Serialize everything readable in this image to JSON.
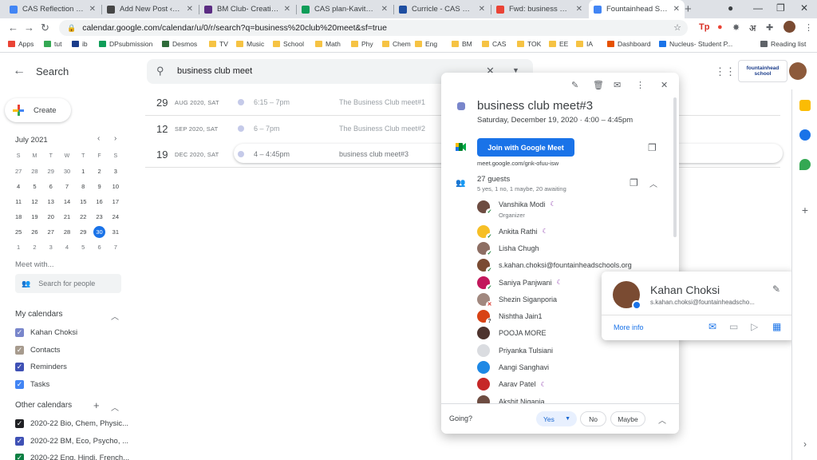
{
  "browser": {
    "tabs": [
      {
        "title": "CAS Reflection format",
        "color": "#4285f4"
      },
      {
        "title": "Add New Post ‹ — Wo",
        "color": "#464646"
      },
      {
        "title": "BM Club- Creativity",
        "color": "#5b2c83"
      },
      {
        "title": "CAS plan-Kavita Agar",
        "color": "#0f9d58"
      },
      {
        "title": "Curricle - CAS Class o",
        "color": "#1e4ea1"
      },
      {
        "title": "Fwd: business club ev",
        "color": "#ea4335"
      },
      {
        "title": "Fountainhead School",
        "color": "#4285f4"
      }
    ],
    "url": "calendar.google.com/calendar/u/0/r/search?q=business%20club%20meet&sf=true",
    "extensions": [
      "Tp",
      "अ"
    ],
    "bookmarks": [
      {
        "label": "Apps",
        "color": "#ea4335"
      },
      {
        "label": "tut",
        "color": "#34a853"
      },
      {
        "label": "ib",
        "color": "#1a3c8a"
      },
      {
        "label": "DPsubmission",
        "color": "#0f9d58"
      },
      {
        "label": "Desmos",
        "color": "#2f6b3a"
      },
      {
        "label": "TV",
        "color": "#f6c343"
      },
      {
        "label": "Music",
        "color": "#f6c343"
      },
      {
        "label": "School",
        "color": "#f6c343"
      },
      {
        "label": "Math",
        "color": "#f6c343"
      },
      {
        "label": "Phy",
        "color": "#f6c343"
      },
      {
        "label": "Chem",
        "color": "#f6c343"
      },
      {
        "label": "Eng",
        "color": "#f6c343"
      },
      {
        "label": "BM",
        "color": "#f6c343"
      },
      {
        "label": "CAS",
        "color": "#f6c343"
      },
      {
        "label": "TOK",
        "color": "#f6c343"
      },
      {
        "label": "EE",
        "color": "#f6c343"
      },
      {
        "label": "IA",
        "color": "#f6c343"
      },
      {
        "label": "Dashboard",
        "color": "#e65100"
      },
      {
        "label": "Nucleus- Student P...",
        "color": "#1a73e8"
      }
    ],
    "reading_list": "Reading list"
  },
  "header": {
    "page_title": "Search",
    "query": "business club meet",
    "org_logo": "fountainhead school"
  },
  "sidebar": {
    "create_label": "Create",
    "month_title": "July 2021",
    "weekdays": [
      "S",
      "M",
      "T",
      "W",
      "T",
      "F",
      "S"
    ],
    "weeks": [
      [
        "27",
        "28",
        "29",
        "30",
        "1",
        "2",
        "3"
      ],
      [
        "4",
        "5",
        "6",
        "7",
        "8",
        "9",
        "10"
      ],
      [
        "11",
        "12",
        "13",
        "14",
        "15",
        "16",
        "17"
      ],
      [
        "18",
        "19",
        "20",
        "21",
        "22",
        "23",
        "24"
      ],
      [
        "25",
        "26",
        "27",
        "28",
        "29",
        "30",
        "31"
      ],
      [
        "1",
        "2",
        "3",
        "4",
        "5",
        "6",
        "7"
      ]
    ],
    "today": "30",
    "meet_with": "Meet with...",
    "people_placeholder": "Search for people",
    "my_calendars_title": "My calendars",
    "my_calendars": [
      {
        "label": "Kahan Choksi",
        "color": "#7986cb"
      },
      {
        "label": "Contacts",
        "color": "#a79b8e"
      },
      {
        "label": "Reminders",
        "color": "#3f51b5"
      },
      {
        "label": "Tasks",
        "color": "#4285f4"
      }
    ],
    "other_calendars_title": "Other calendars",
    "other_calendars": [
      {
        "label": "2020-22 Bio, Chem, Physic...",
        "color": "#202124"
      },
      {
        "label": "2020-22 BM, Eco, Psycho, ...",
        "color": "#3f51b5"
      },
      {
        "label": "2020-22 Eng, Hindi, French...",
        "color": "#0b8043"
      }
    ]
  },
  "results": [
    {
      "day": "29",
      "month": "AUG 2020, SAT",
      "time": "6:15 – 7pm",
      "title": "The Business Club meet#1"
    },
    {
      "day": "12",
      "month": "SEP 2020, SAT",
      "time": "6 – 7pm",
      "title": "The Business Club meet#2"
    },
    {
      "day": "19",
      "month": "DEC 2020, SAT",
      "time": "4 – 4:45pm",
      "title": "business club meet#3"
    }
  ],
  "event": {
    "title": "business club meet#3",
    "when": "Saturday, December 19, 2020  ·  4:00 – 4:45pm",
    "join_label": "Join with Google Meet",
    "meet_link": "meet.google.com/gnk-ofuu-isw",
    "guest_count": "27 guests",
    "guest_summary": "5 yes, 1 no, 1 maybe, 20 awaiting",
    "organizer_label": "Organizer",
    "guests": [
      {
        "name": "Vanshika Modi",
        "status": "yes",
        "moon": true,
        "color": "#6d4c41"
      },
      {
        "name": "Ankita Rathi",
        "status": "yes",
        "moon": true,
        "color": "#f6bf26"
      },
      {
        "name": "Lisha Chugh",
        "status": "yes",
        "moon": false,
        "color": "#8d6e63"
      },
      {
        "name": "s.kahan.choksi@fountainheadschools.org",
        "status": "yes",
        "moon": false,
        "color": "#7a4b32"
      },
      {
        "name": "Saniya Panjwani",
        "status": "yes",
        "moon": true,
        "color": "#c2185b"
      },
      {
        "name": "Shezin Siganporia",
        "status": "no",
        "moon": false,
        "color": "#a1887f"
      },
      {
        "name": "Nishtha Jain1",
        "status": "maybe",
        "moon": false,
        "color": "#d84315"
      },
      {
        "name": "POOJA MORE",
        "status": "",
        "moon": false,
        "color": "#4e342e"
      },
      {
        "name": "Priyanka Tulsiani",
        "status": "",
        "moon": false,
        "color": "#dadce0"
      },
      {
        "name": "Aangi Sanghavi",
        "status": "",
        "moon": false,
        "color": "#1e88e5"
      },
      {
        "name": "Aarav Patel",
        "status": "",
        "moon": true,
        "color": "#c62828"
      },
      {
        "name": "Akshit Nigania",
        "status": "",
        "moon": false,
        "color": "#6d4c41"
      }
    ],
    "going_label": "Going?",
    "rsvp_yes": "Yes",
    "rsvp_no": "No",
    "rsvp_maybe": "Maybe"
  },
  "hovercard": {
    "name": "Kahan Choksi",
    "email": "s.kahan.choksi@fountainheadscho...",
    "more_info": "More info"
  },
  "colors": {
    "accent": "#1a73e8",
    "event": "#7986cb"
  }
}
